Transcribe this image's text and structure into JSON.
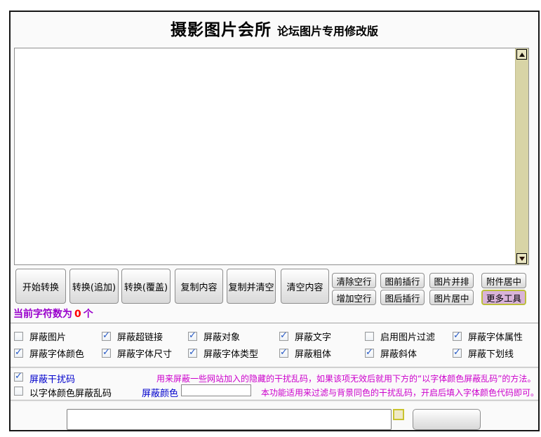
{
  "header": {
    "title": "摄影图片会所",
    "subtitle": "论坛图片专用修改版"
  },
  "editor": {
    "value": "",
    "char_count_label": "当前字符数为",
    "char_count": "0",
    "char_count_unit": "个"
  },
  "actions": {
    "primary": [
      "开始转换",
      "转换(追加)",
      "转换(覆盖)",
      "复制内容",
      "复制并清空",
      "清空内容"
    ],
    "secondary_row1": [
      "清除空行",
      "图前插行",
      "图片并排",
      "附件居中"
    ],
    "secondary_row2": [
      "增加空行",
      "图后插行",
      "图片居中",
      "更多工具"
    ]
  },
  "filters": {
    "row1": [
      {
        "label": "屏蔽图片",
        "checked": false
      },
      {
        "label": "屏蔽超链接",
        "checked": true
      },
      {
        "label": "屏蔽对象",
        "checked": true
      },
      {
        "label": "屏蔽文字",
        "checked": true
      },
      {
        "label": "启用图片过滤",
        "checked": false
      },
      {
        "label": "屏蔽字体属性",
        "checked": true
      }
    ],
    "row2": [
      {
        "label": "屏蔽字体颜色",
        "checked": true
      },
      {
        "label": "屏蔽字体尺寸",
        "checked": true
      },
      {
        "label": "屏蔽字体类型",
        "checked": true
      },
      {
        "label": "屏蔽粗体",
        "checked": true
      },
      {
        "label": "屏蔽斜体",
        "checked": true
      },
      {
        "label": "屏蔽下划线",
        "checked": true
      }
    ]
  },
  "noise": {
    "block_label": "屏蔽干扰码",
    "block_checked": true,
    "block_hint": "用来屏蔽一些网站加入的隐藏的干扰乱码，如果该项无效后就用下方的“以字体颜色屏蔽乱码”的方法。",
    "color_label": "以字体颜色屏蔽乱码",
    "color_checked": false,
    "color_field_label": "屏蔽颜色",
    "color_value": "",
    "color_hint": "本功能适用来过滤与背景同色的干扰乱码，开启后填入字体颜色代码即可。"
  },
  "colors": {
    "hint_text": "#cc00cc",
    "label_blue": "#0000cc",
    "count_red": "#ff0000",
    "count_purple": "#9900cc",
    "more_tools_bg": "#d9b3d9",
    "more_tools_border": "#bcbe3c",
    "scrollbar_track": "#d8d4a6"
  }
}
